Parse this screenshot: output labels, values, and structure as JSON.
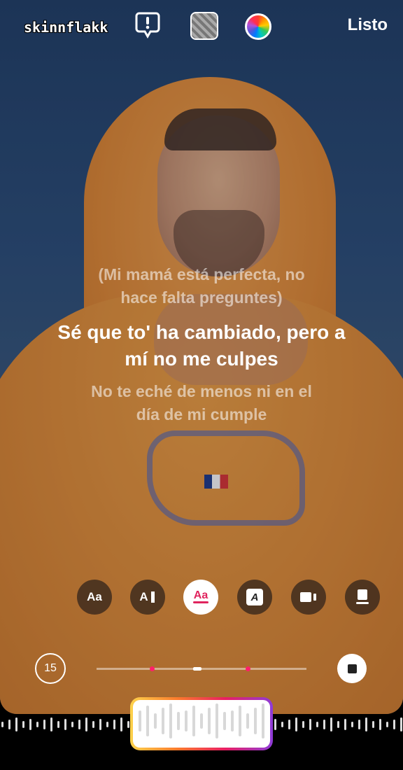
{
  "topbar": {
    "username": "skinnflakk",
    "done_label": "Listo"
  },
  "icons": {
    "report": "report-icon",
    "thumbnail": "cover-thumbnail",
    "color": "color-wheel-icon"
  },
  "lyrics": {
    "previous": [
      "(Mi mamá está perfecta, no",
      "hace falta preguntes)"
    ],
    "current": [
      "Sé que to' ha cambiado, pero a",
      "mí no me culpes"
    ],
    "next": [
      "No te eché de menos ni en el",
      "día de mi cumple"
    ]
  },
  "styles": {
    "labels": [
      "Aa",
      "A",
      "Aa",
      "A"
    ],
    "selected_index": 2
  },
  "player": {
    "duration": "15"
  },
  "colors": {
    "accent": "#ff1f6a",
    "gradient": [
      "#fdd24b",
      "#fc7a2b",
      "#e91e63",
      "#8e3bd8"
    ]
  }
}
